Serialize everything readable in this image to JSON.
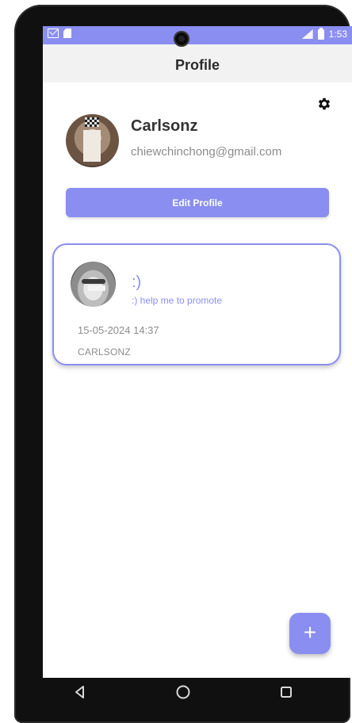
{
  "status_bar": {
    "time": "1:53",
    "icons": [
      "mail-icon",
      "sd-card-icon",
      "signal-icon",
      "battery-icon"
    ]
  },
  "app_bar": {
    "title": "Profile"
  },
  "profile": {
    "name": "Carlsonz",
    "email": "chiewchinchong@gmail.com",
    "edit_button_label": "Edit Profile",
    "settings_icon": "gear-icon"
  },
  "posts": [
    {
      "title": ":)",
      "subtitle": ":) help me to promote",
      "datetime": "15-05-2024 14:37",
      "author": "CARLSONZ"
    }
  ],
  "fab": {
    "label": "+",
    "icon": "add-icon"
  },
  "nav": {
    "icons": [
      "back-icon",
      "home-icon",
      "recents-icon"
    ]
  },
  "colors": {
    "accent": "#8a8ef0",
    "app_bar_bg": "#f2f2f2",
    "text_dark": "#333333",
    "text_muted": "#8c8c8c"
  }
}
